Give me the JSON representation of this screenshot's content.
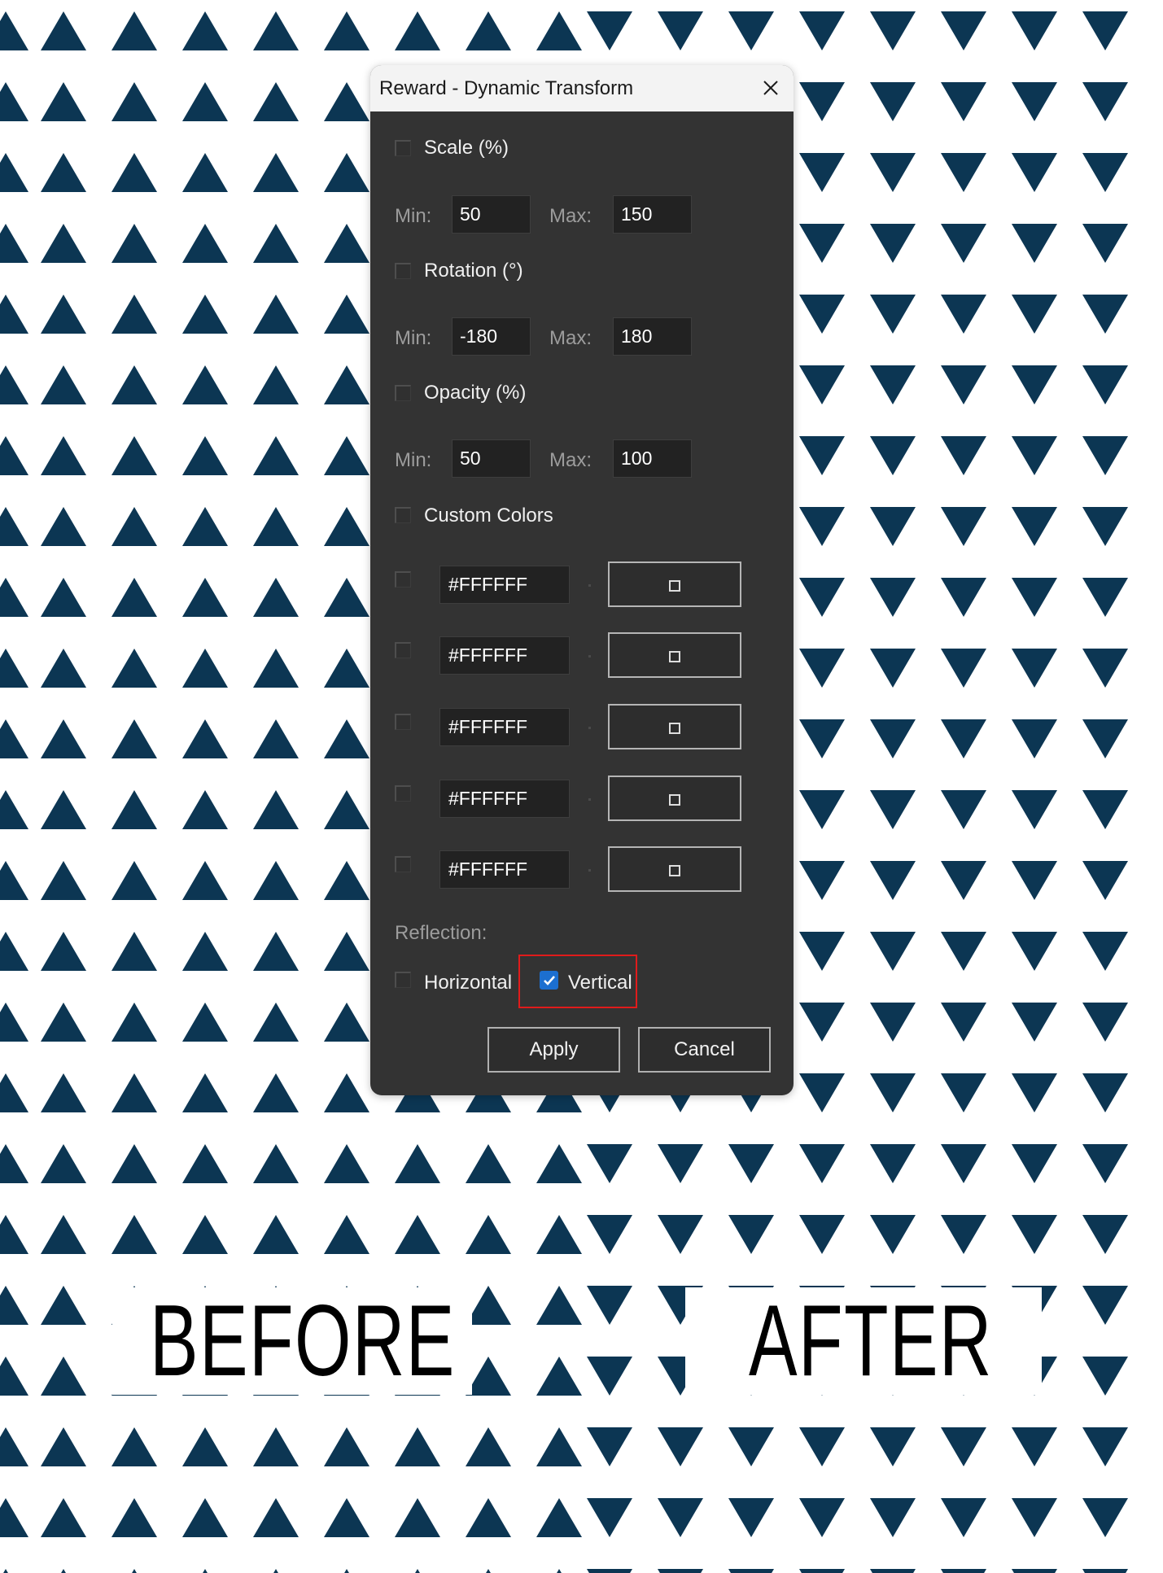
{
  "dialog": {
    "title": "Reward - Dynamic Transform",
    "scale": {
      "label": "Scale (%)",
      "checked": false,
      "min_label": "Min:",
      "min": "50",
      "max_label": "Max:",
      "max": "150"
    },
    "rotation": {
      "label": "Rotation (°)",
      "checked": false,
      "min_label": "Min:",
      "min": "-180",
      "max_label": "Max:",
      "max": "180"
    },
    "opacity": {
      "label": "Opacity (%)",
      "checked": false,
      "min_label": "Min:",
      "min": "50",
      "max_label": "Max:",
      "max": "100"
    },
    "custom_colors": {
      "label": "Custom Colors",
      "checked": false,
      "rows": [
        {
          "value": "#FFFFFF",
          "checked": false
        },
        {
          "value": "#FFFFFF",
          "checked": false
        },
        {
          "value": "#FFFFFF",
          "checked": false
        },
        {
          "value": "#FFFFFF",
          "checked": false
        },
        {
          "value": "#FFFFFF",
          "checked": false
        }
      ],
      "swatch_glyph": "□"
    },
    "reflection": {
      "label": "Reflection:",
      "horizontal_label": "Horizontal",
      "horizontal_checked": false,
      "vertical_label": "Vertical",
      "vertical_checked": true
    },
    "apply_label": "Apply",
    "cancel_label": "Cancel"
  },
  "captions": {
    "before": "BEFORE",
    "after": "AFTER"
  },
  "colors": {
    "triangle": "#0c3653",
    "dialog_bg": "#333333",
    "highlight": "#e01b1b",
    "checkbox_checked": "#1c6fd0"
  },
  "icons": {
    "close": "close-icon",
    "check": "checkmark-icon"
  }
}
